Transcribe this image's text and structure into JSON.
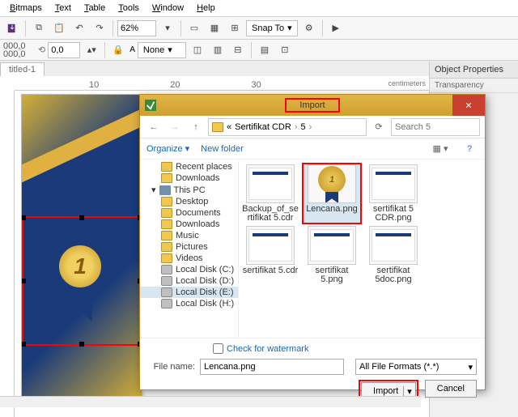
{
  "menu": [
    "Bitmaps",
    "Text",
    "Table",
    "Tools",
    "Window",
    "Help"
  ],
  "toolbar": {
    "zoom": "62%",
    "snap": "Snap To"
  },
  "props": {
    "x": "000,0",
    "y": "000,0",
    "nudge": "0,0",
    "style": "None"
  },
  "doc_tab": "titled-1",
  "ruler_marks": [
    "",
    "10",
    "20",
    "30"
  ],
  "ruler_unit": "centimeters",
  "docker": {
    "title": "Object Properties",
    "sub": "Transparency"
  },
  "page_medal": "1",
  "dialog": {
    "title": "Import",
    "crumb": [
      "Sertifikat CDR",
      "5"
    ],
    "search_ph": "Search 5",
    "organize": "Organize",
    "newfolder": "New folder",
    "tree": [
      {
        "label": "Recent places",
        "icon": "folder",
        "sub": true
      },
      {
        "label": "Downloads",
        "icon": "folder",
        "sub": true
      },
      {
        "label": "This PC",
        "icon": "pc",
        "sub": false,
        "exp": true
      },
      {
        "label": "Desktop",
        "icon": "folder",
        "sub": true
      },
      {
        "label": "Documents",
        "icon": "folder",
        "sub": true
      },
      {
        "label": "Downloads",
        "icon": "folder",
        "sub": true
      },
      {
        "label": "Music",
        "icon": "folder",
        "sub": true
      },
      {
        "label": "Pictures",
        "icon": "folder",
        "sub": true
      },
      {
        "label": "Videos",
        "icon": "folder",
        "sub": true
      },
      {
        "label": "Local Disk (C:)",
        "icon": "disk",
        "sub": true
      },
      {
        "label": "Local Disk (D:)",
        "icon": "disk",
        "sub": true
      },
      {
        "label": "Local Disk (E:)",
        "icon": "disk",
        "sub": true,
        "sel": true
      },
      {
        "label": "Local Disk (H:)",
        "icon": "disk",
        "sub": true
      }
    ],
    "files": [
      {
        "name": "Backup_of_sertifikat 5.cdr",
        "type": "cert"
      },
      {
        "name": "Lencana.png",
        "type": "medal",
        "sel": true
      },
      {
        "name": "sertifikat 5 CDR.png",
        "type": "cert"
      },
      {
        "name": "sertifikat 5.cdr",
        "type": "cert"
      },
      {
        "name": "sertifikat 5.png",
        "type": "cert"
      },
      {
        "name": "sertifikat 5doc.png",
        "type": "cert"
      }
    ],
    "check_watermark": "Check for watermark",
    "filename_label": "File name:",
    "filename": "Lencana.png",
    "filter": "All File Formats (*.*)",
    "import_btn": "Import",
    "cancel_btn": "Cancel"
  }
}
